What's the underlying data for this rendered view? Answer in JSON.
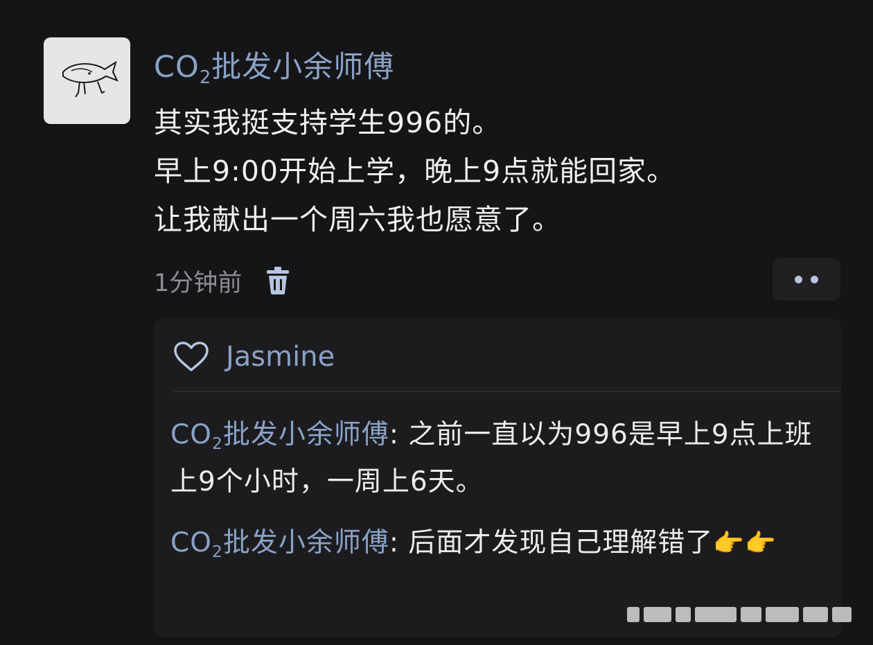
{
  "post": {
    "author_prefix": "CO",
    "author_sub": "2",
    "author_rest": "批发小余师傅",
    "lines": [
      "其实我挺支持学生996的。",
      "早上9:00开始上学，晚上9点就能回家。",
      "让我献出一个周六我也愿意了。"
    ],
    "time": "1分钟前",
    "delete_icon": "trash-icon",
    "more_icon": "more-dots-icon"
  },
  "likes": {
    "icon": "heart-icon",
    "names": "Jasmine"
  },
  "comments": [
    {
      "author_prefix": "CO",
      "author_sub": "2",
      "author_rest": "批发小余师傅",
      "text": ": 之前一直以为996是早上9点上班上9个小时，一周上6天。"
    },
    {
      "author_prefix": "CO",
      "author_sub": "2",
      "author_rest": "批发小余师傅",
      "text": ": 后面才发现自己理解错了",
      "emoji": "👉👉"
    }
  ],
  "colors": {
    "background": "#151517",
    "panel": "#1c1c1f",
    "name_blue": "#8aa2c8",
    "text": "#f0f0f2",
    "muted": "#8d8d92"
  }
}
